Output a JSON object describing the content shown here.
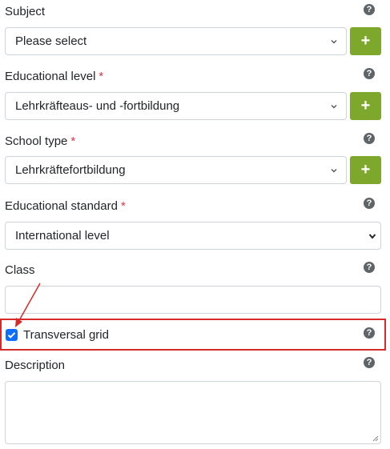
{
  "subject": {
    "label": "Subject",
    "value": "Please select",
    "help": "?",
    "add": "+"
  },
  "educational_level": {
    "label": "Educational level",
    "required": "*",
    "value": "Lehrkräfteaus- und -fortbildung",
    "help": "?",
    "add": "+"
  },
  "school_type": {
    "label": "School type",
    "required": "*",
    "value": "Lehrkräftefortbildung",
    "help": "?",
    "add": "+"
  },
  "educational_standard": {
    "label": "Educational standard",
    "required": "*",
    "value": "International level",
    "help": "?"
  },
  "class": {
    "label": "Class",
    "value": "",
    "help": "?"
  },
  "transversal_grid": {
    "label": "Transversal grid",
    "checked": true,
    "help": "?"
  },
  "description": {
    "label": "Description",
    "value": "",
    "help": "?"
  },
  "colors": {
    "accent_green": "#7ea82c",
    "checkbox_blue": "#0d6efd",
    "annotation_red": "#d72b2b",
    "required_red": "#dc3545"
  }
}
